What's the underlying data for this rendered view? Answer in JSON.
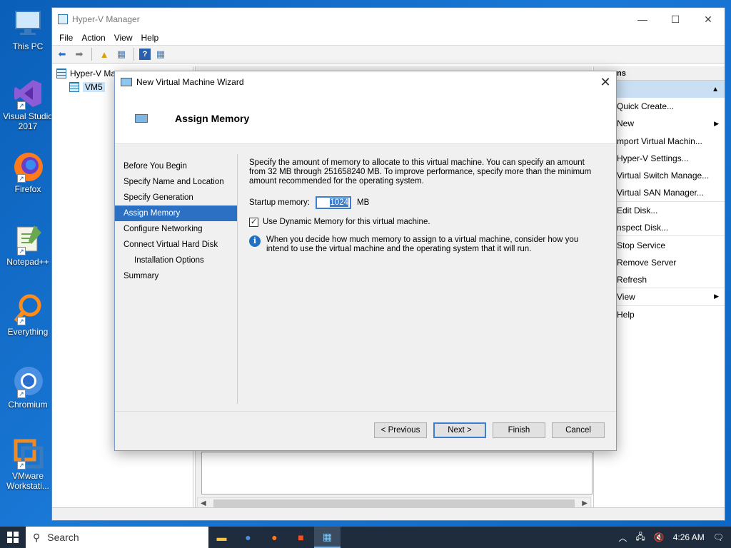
{
  "desktop": {
    "icons": [
      {
        "label": "This PC"
      },
      {
        "label": "Visual Studio 2017"
      },
      {
        "label": "Firefox"
      },
      {
        "label": "Notepad++"
      },
      {
        "label": "Everything"
      },
      {
        "label": "Chromium"
      },
      {
        "label": "VMware Workstati..."
      }
    ]
  },
  "mainwin": {
    "title": "Hyper-V Manager",
    "controls": {
      "minimize": "—",
      "maximize": "☐",
      "close": "✕"
    },
    "menu": [
      "File",
      "Action",
      "View",
      "Help"
    ],
    "tree": {
      "root": "Hyper-V Ma",
      "child": "VM5"
    },
    "actions": {
      "header": "ns",
      "items": [
        "Quick Create...",
        "New",
        "mport Virtual Machin...",
        "Hyper-V Settings...",
        "Virtual Switch Manage...",
        "Virtual SAN Manager...",
        "Edit Disk...",
        "nspect Disk...",
        "Stop Service",
        "Remove Server",
        "Refresh",
        "View",
        "Help"
      ]
    }
  },
  "wizard": {
    "title": "New Virtual Machine Wizard",
    "heading": "Assign Memory",
    "nav": [
      "Before You Begin",
      "Specify Name and Location",
      "Specify Generation",
      "Assign Memory",
      "Configure Networking",
      "Connect Virtual Hard Disk",
      "Installation Options",
      "Summary"
    ],
    "description": "Specify the amount of memory to allocate to this virtual machine. You can specify an amount from 32 MB through 251658240 MB. To improve performance, specify more than the minimum amount recommended for the operating system.",
    "startup_label": "Startup memory:",
    "startup_value": "1024",
    "startup_unit": "MB",
    "dynamic_label": "Use Dynamic Memory for this virtual machine.",
    "dynamic_checked": true,
    "info_text": "When you decide how much memory to assign to a virtual machine, consider how you intend to use the virtual machine and the operating system that it will run.",
    "buttons": {
      "previous": "< Previous",
      "next": "Next >",
      "finish": "Finish",
      "cancel": "Cancel"
    }
  },
  "taskbar": {
    "search_placeholder": "Search",
    "time": "4:26 AM"
  }
}
